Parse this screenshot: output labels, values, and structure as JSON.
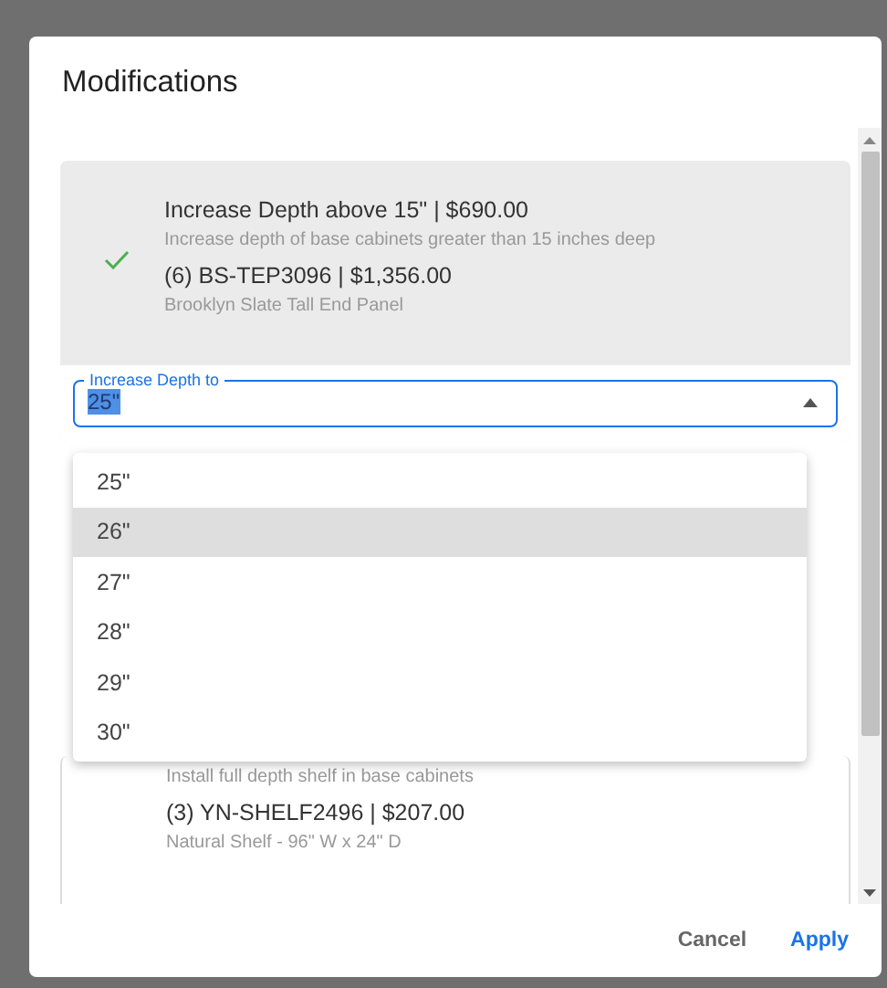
{
  "dialog": {
    "title": "Modifications"
  },
  "cards": [
    {
      "checked": true,
      "title": "Increase Depth above 15\" | $690.00",
      "description": "Increase depth of base cabinets greater than 15 inches deep",
      "product": "(6) BS-TEP3096 | $1,356.00",
      "product_name": "Brooklyn Slate Tall End Panel",
      "field": {
        "label": "Increase Depth to",
        "value": "25\"",
        "expanded": true
      }
    },
    {
      "checked": false,
      "description": "Install full depth shelf in base cabinets",
      "product": "(3) YN-SHELF2496 | $207.00",
      "product_name": "Natural Shelf - 96\" W x 24\" D"
    }
  ],
  "menu": [
    {
      "label": "25\"",
      "highlighted": false
    },
    {
      "label": "26\"",
      "highlighted": true
    },
    {
      "label": "27\"",
      "highlighted": false
    },
    {
      "label": "28\"",
      "highlighted": false
    },
    {
      "label": "29\"",
      "highlighted": false
    },
    {
      "label": "30\"",
      "highlighted": false
    }
  ],
  "buttons": [
    {
      "label": "Cancel",
      "kind": "secondary"
    },
    {
      "label": "Apply",
      "kind": "primary"
    }
  ]
}
